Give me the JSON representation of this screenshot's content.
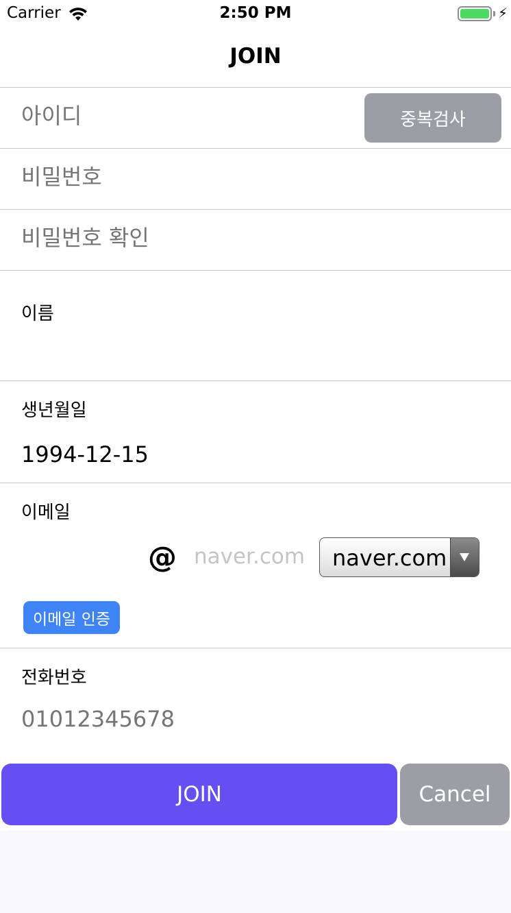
{
  "status_bar": {
    "carrier": "Carrier",
    "time": "2:50 PM",
    "bolt": "⚡"
  },
  "nav": {
    "title": "JOIN"
  },
  "form": {
    "id_placeholder": "아이디",
    "dup_check_label": "중복검사",
    "password_placeholder": "비밀번호",
    "password_confirm_placeholder": "비밀번호 확인",
    "name_label": "이름",
    "birth_label": "생년월일",
    "birth_value": "1994-12-15",
    "email_label": "이메일",
    "at_sign": "@",
    "email_domain_placeholder": "naver.com",
    "email_domain_selected": "naver.com",
    "email_verify_label": "이메일 인증",
    "phone_label": "전화번호",
    "phone_placeholder": "01012345678"
  },
  "actions": {
    "join_label": "JOIN",
    "cancel_label": "Cancel"
  },
  "colors": {
    "join": "#644ff1",
    "cancel": "#9b9ea5",
    "verify": "#3f84f6",
    "dup_check": "#9a9da4",
    "battery": "#4cd964"
  }
}
